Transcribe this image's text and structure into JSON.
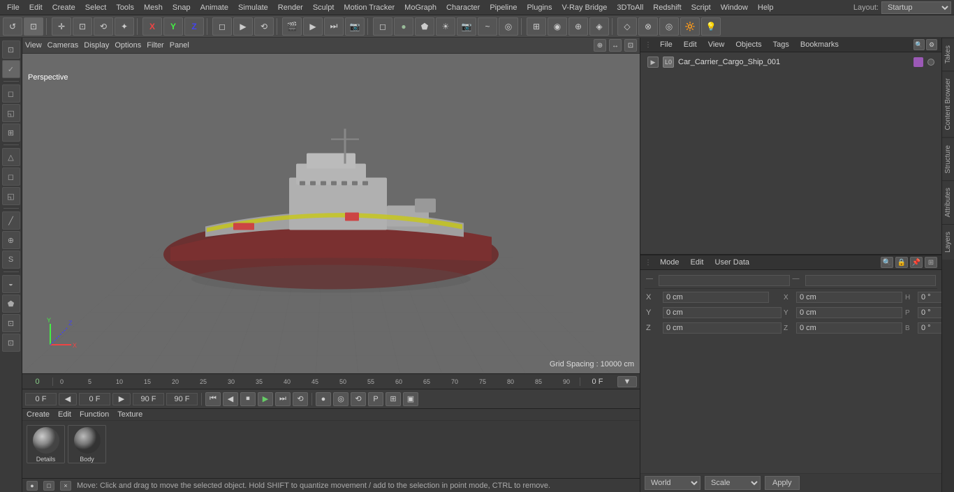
{
  "menubar": {
    "items": [
      "File",
      "Edit",
      "Create",
      "Select",
      "Tools",
      "Mesh",
      "Snap",
      "Animate",
      "Simulate",
      "Render",
      "Sculpt",
      "Motion Tracker",
      "MoGraph",
      "Character",
      "Pipeline",
      "Plugins",
      "V-Ray Bridge",
      "3DToAll",
      "Redshift",
      "Script",
      "Window",
      "Help"
    ],
    "layout_label": "Layout:",
    "layout_value": "Startup"
  },
  "toolbar": {
    "buttons": [
      "↺",
      "⊡",
      "↔",
      "⟳",
      "✛",
      "X",
      "Y",
      "Z",
      "◻",
      "▷",
      "⟲",
      "⊕",
      "◈",
      "⊗",
      "⊟",
      "▣",
      "●",
      "◎",
      "⊞",
      "◉",
      "🎬",
      "▶",
      "⏭",
      "📷",
      "◉",
      "▢",
      "✦",
      "⬟",
      "✧",
      "◈",
      "◇",
      "💡"
    ]
  },
  "viewport": {
    "menus": [
      "View",
      "Cameras",
      "Display",
      "Options",
      "Filter",
      "Panel"
    ],
    "perspective_label": "Perspective",
    "grid_spacing": "Grid Spacing : 10000 cm"
  },
  "timeline": {
    "ticks": [
      "0",
      "5",
      "10",
      "15",
      "20",
      "25",
      "30",
      "35",
      "40",
      "45",
      "50",
      "55",
      "60",
      "65",
      "70",
      "75",
      "80",
      "85",
      "90"
    ],
    "current_frame": "0 F"
  },
  "playback": {
    "frame_start": "0 F",
    "frame_end_1": "90 F",
    "frame_end_2": "90 F",
    "current": "0 F",
    "buttons": [
      "⏮",
      "◀",
      "⏸",
      "▶",
      "⏭",
      "⟲"
    ],
    "extra_btns": [
      "⊕",
      "◎",
      "⟳",
      "P",
      "⊞",
      "▣"
    ]
  },
  "material": {
    "menus": [
      "Create",
      "Edit",
      "Function",
      "Texture"
    ],
    "items": [
      {
        "label": "Details",
        "color1": "#888",
        "color2": "#999"
      },
      {
        "label": "Body",
        "color1": "#666",
        "color2": "#777"
      }
    ]
  },
  "status": {
    "text": "Move: Click and drag to move the selected object. Hold SHIFT to quantize movement / add to the selection in point mode, CTRL to remove.",
    "icons": [
      "●",
      "□",
      "×"
    ]
  },
  "obj_manager": {
    "menus": [
      "File",
      "Edit",
      "View",
      "Objects",
      "Tags",
      "Bookmarks"
    ],
    "item": {
      "name": "Car_Carrier_Cargo_Ship_001",
      "color": "#9b59b6"
    }
  },
  "attr_panel": {
    "menus": [
      "Mode",
      "Edit",
      "User Data"
    ],
    "coord_section": {
      "pos": {
        "x": "0 cm",
        "y": "0 cm",
        "z": "0 cm"
      },
      "rot": {
        "h": "0 °",
        "p": "0 °",
        "b": "0 °"
      },
      "scale": {
        "x": "0 cm",
        "y": "0 cm",
        "z": "0 cm"
      },
      "labels": {
        "pos_x": "X",
        "pos_y": "Y",
        "pos_z": "Z",
        "rot_h": "H",
        "rot_p": "P",
        "rot_b": "B"
      }
    },
    "world_label": "World",
    "scale_label": "Scale",
    "apply_label": "Apply"
  },
  "right_tabs": [
    "Takes",
    "Content Browser",
    "Structure",
    "Attributes",
    "Layers"
  ],
  "icons": {
    "undo": "↺",
    "camera": "📷",
    "move": "✛",
    "rotate": "⟲",
    "scale": "⊕",
    "x_axis": "X",
    "y_axis": "Y",
    "z_axis": "Z",
    "play": "▶",
    "stop": "⏹",
    "rewind": "⏮",
    "forward": "⏭"
  }
}
